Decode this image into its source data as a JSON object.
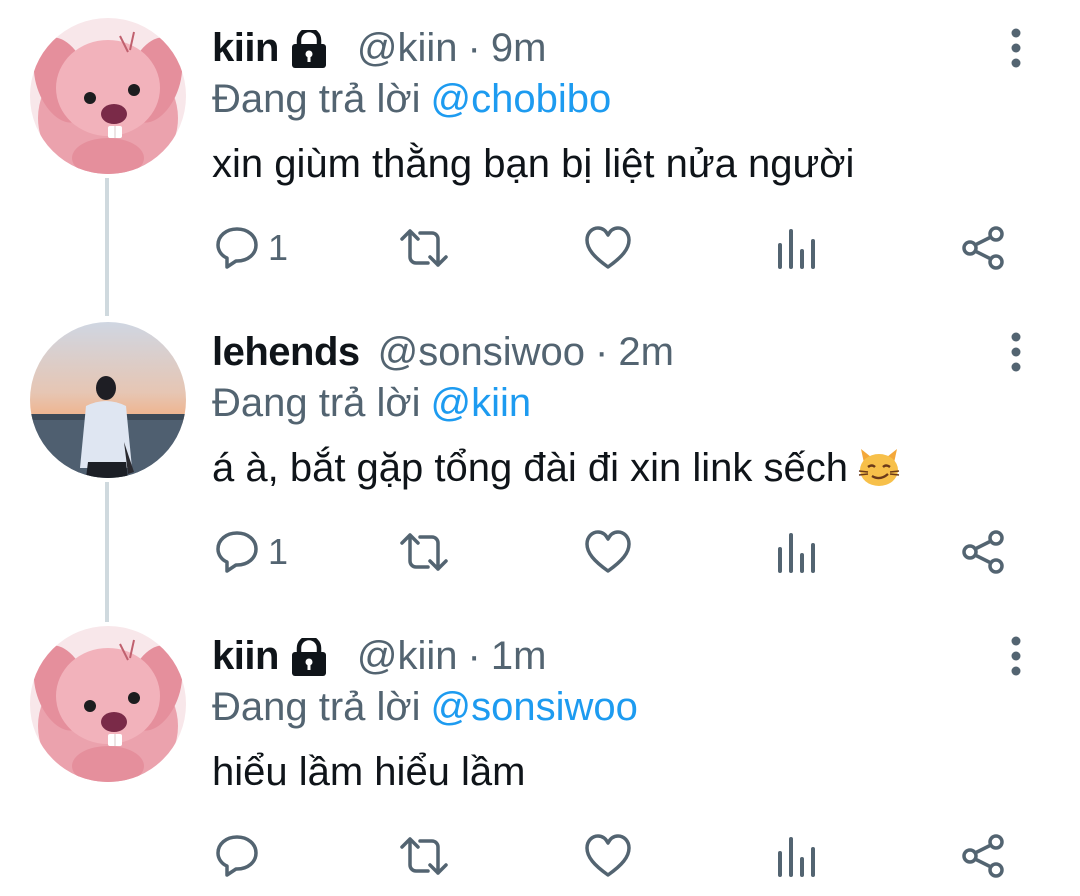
{
  "colors": {
    "text_primary": "#0f1419",
    "text_secondary": "#536471",
    "link": "#1d9bf0",
    "icon": "#536471",
    "thread_line": "#cfd9de"
  },
  "tweets": [
    {
      "display_name": "kiin",
      "locked": true,
      "handle": "@kiin",
      "separator": "·",
      "time": "9m",
      "replying_prefix": "Đang trả lời",
      "replying_to": "@chobibo",
      "text": "xin giùm thằng bạn bị liệt nửa người",
      "avatar": "pink-beaver-avatar",
      "reply_count": "1"
    },
    {
      "display_name": "lehends",
      "locked": false,
      "handle": "@sonsiwoo",
      "separator": "·",
      "time": "2m",
      "replying_prefix": "Đang trả lời",
      "replying_to": "@kiin",
      "text": "á à, bắt gặp tổng đài đi xin link sếch",
      "emoji": "smirking-cat-emoji",
      "avatar": "sunset-photo-avatar",
      "reply_count": "1"
    },
    {
      "display_name": "kiin",
      "locked": true,
      "handle": "@kiin",
      "separator": "·",
      "time": "1m",
      "replying_prefix": "Đang trả lời",
      "replying_to": "@sonsiwoo",
      "text": "hiểu lầm hiểu lầm",
      "avatar": "pink-beaver-avatar",
      "reply_count": ""
    }
  ]
}
